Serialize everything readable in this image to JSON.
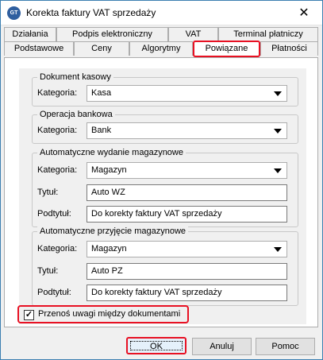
{
  "window": {
    "title": "Korekta faktury VAT sprzedaży"
  },
  "tabs_row1": [
    "Działania",
    "Podpis elektroniczny",
    "VAT",
    "Terminal płatniczy"
  ],
  "tabs_row2": [
    "Podstawowe",
    "Ceny",
    "Algorytmy",
    "Powiązane",
    "Płatności"
  ],
  "active_tab": "Powiązane",
  "groups": {
    "cash": {
      "legend": "Dokument kasowy",
      "category_label": "Kategoria:",
      "category_value": "Kasa"
    },
    "bank": {
      "legend": "Operacja bankowa",
      "category_label": "Kategoria:",
      "category_value": "Bank"
    },
    "out": {
      "legend": "Automatyczne wydanie magazynowe",
      "category_label": "Kategoria:",
      "category_value": "Magazyn",
      "title_label": "Tytuł:",
      "title_value": "Auto WZ",
      "subtitle_label": "Podtytuł:",
      "subtitle_value": "Do korekty faktury VAT sprzedaży"
    },
    "in": {
      "legend": "Automatyczne przyjęcie magazynowe",
      "category_label": "Kategoria:",
      "category_value": "Magazyn",
      "title_label": "Tytuł:",
      "title_value": "Auto PZ",
      "subtitle_label": "Podtytuł:",
      "subtitle_value": "Do korekty faktury VAT sprzedaży"
    }
  },
  "transfer_notes": {
    "label": "Przenoś uwagi między dokumentami",
    "checked": true
  },
  "buttons": {
    "ok": "OK",
    "cancel": "Anuluj",
    "help": "Pomoc"
  },
  "colors": {
    "highlight": "#e81123",
    "window_border": "#3c7fb1"
  }
}
